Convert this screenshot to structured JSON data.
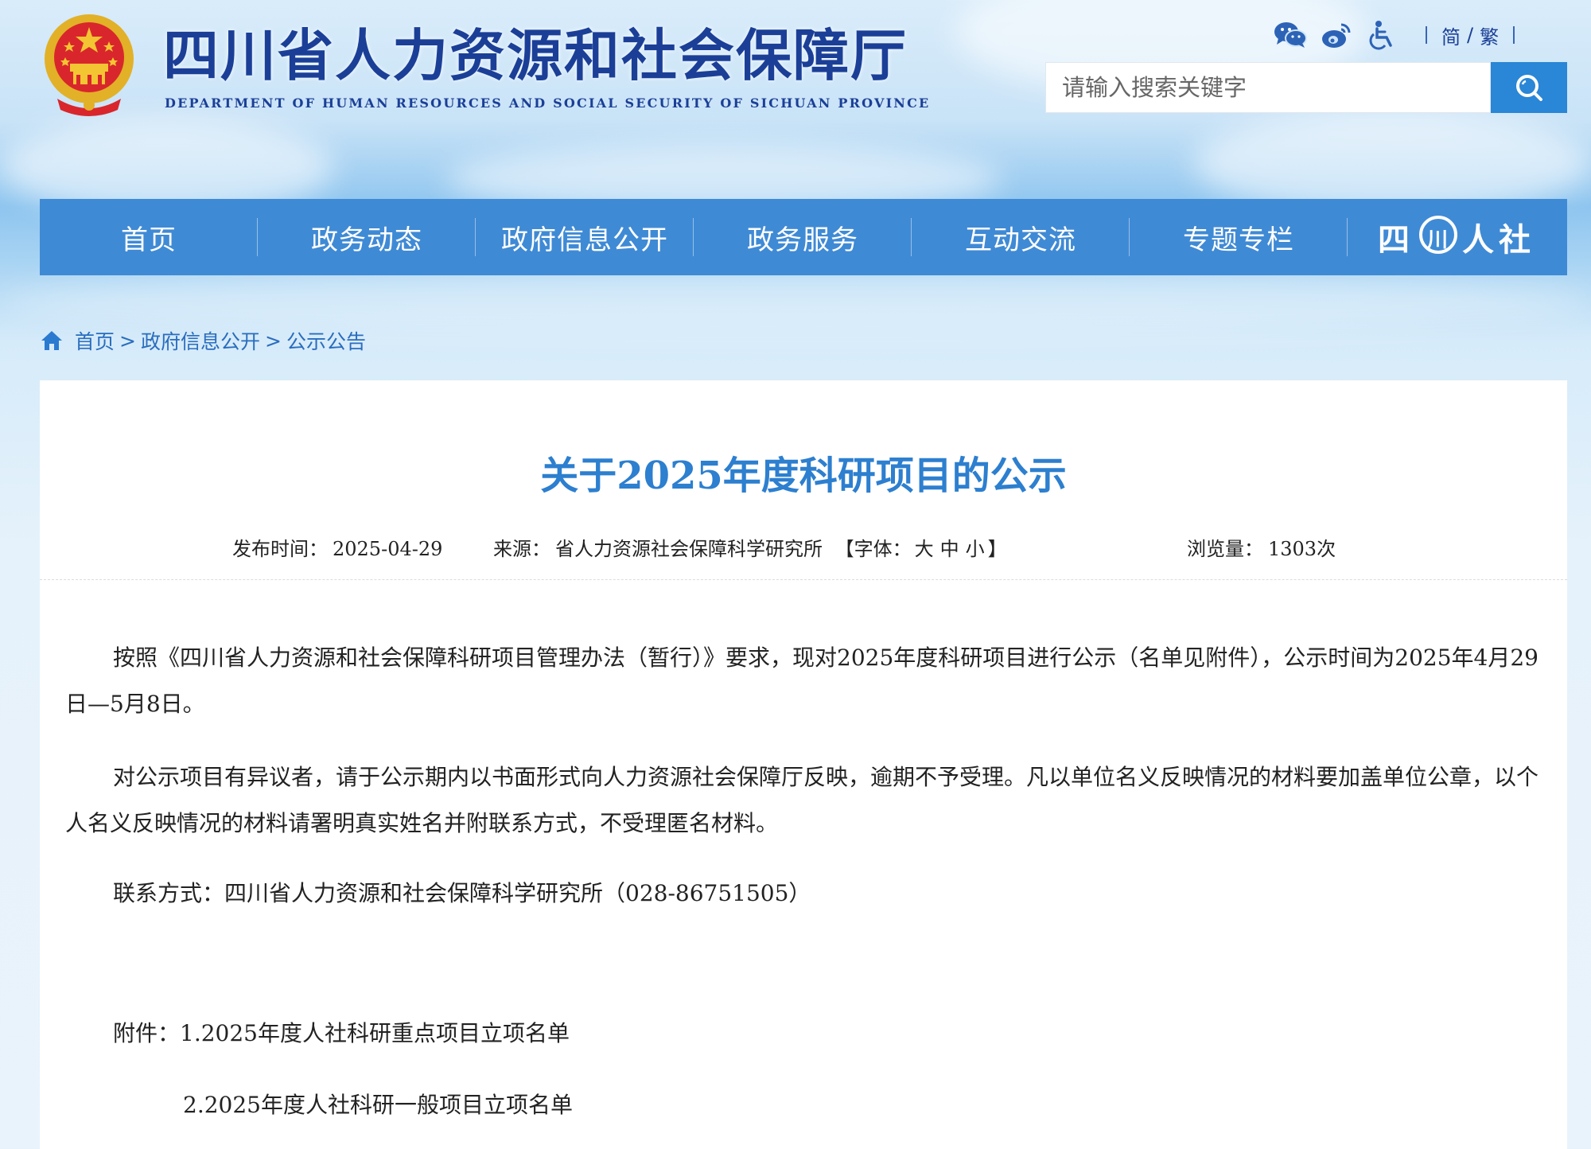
{
  "header": {
    "site_title": "四川省人力资源和社会保障厅",
    "site_subtitle": "DEPARTMENT OF HUMAN RESOURCES AND SOCIAL SECURITY OF SICHUAN PROVINCE",
    "lang_simplified": "简",
    "lang_slash": "/",
    "lang_traditional": "繁"
  },
  "search": {
    "placeholder": "请输入搜索关键字"
  },
  "nav": {
    "items": [
      "首页",
      "政务动态",
      "政府信息公开",
      "政务服务",
      "互动交流",
      "专题专栏"
    ],
    "logo_left": "四",
    "logo_mid": "川",
    "logo_right": "人社"
  },
  "breadcrumb": {
    "home": "首页",
    "sep": ">",
    "level2": "政府信息公开",
    "level3": "公示公告"
  },
  "article": {
    "title": "关于2025年度科研项目的公示",
    "publish_label": "发布时间：",
    "publish_date": "2025-04-29",
    "source_label": "来源：",
    "source": "省人力资源社会保障科学研究所",
    "font_label_open": "【字体：",
    "font_large": "大",
    "font_medium": "中",
    "font_small": "小",
    "font_label_close": "】",
    "views_label": "浏览量：",
    "views": "1303次",
    "paragraphs": [
      "按照《四川省人力资源和社会保障科研项目管理办法（暂行）》要求，现对2025年度科研项目进行公示（名单见附件），公示时间为2025年4月29日—5月8日。",
      "对公示项目有异议者，请于公示期内以书面形式向人力资源社会保障厅反映，逾期不予受理。凡以单位名义反映情况的材料要加盖单位公章，以个人名义反映情况的材料请署明真实姓名并附联系方式，不受理匿名材料。",
      "联系方式：四川省人力资源和社会保障科学研究所（028-86751505）",
      "附件：1.2025年度人社科研重点项目立项名单",
      "2.2025年度人社科研一般项目立项名单"
    ]
  },
  "colors": {
    "nav_bg": "#3f8ad5",
    "title_blue": "#2d7fcf",
    "brand_dark": "#1b3f97",
    "search_btn": "#2a86d6"
  }
}
